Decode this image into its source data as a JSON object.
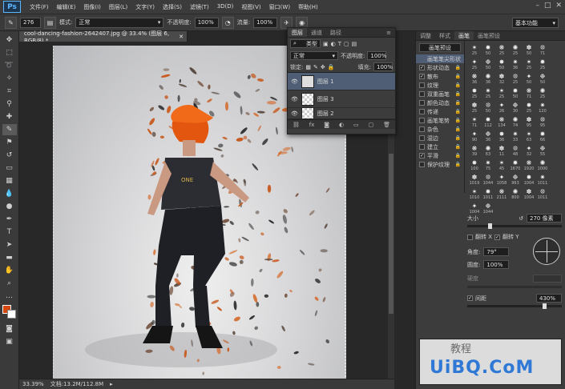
{
  "app": {
    "logo": "Ps",
    "window_buttons": [
      "–",
      "□",
      "✕"
    ]
  },
  "menu": [
    "文件(F)",
    "编辑(E)",
    "图像(I)",
    "图层(L)",
    "文字(Y)",
    "选择(S)",
    "滤镜(T)",
    "3D(D)",
    "视图(V)",
    "窗口(W)",
    "帮助(H)"
  ],
  "options": {
    "brush_size": "276",
    "mode_label": "模式:",
    "mode_value": "正常",
    "opacity_label": "不透明度:",
    "opacity_value": "100%",
    "flow_label": "流量:",
    "flow_value": "100%",
    "workspace": "基本功能"
  },
  "document": {
    "tab_title": "cool-dancing-fashion-2642407.jpg @ 33.4% (图层 6, RGB/8) *",
    "zoom": "33.39%",
    "doc_size": "文档:13.2M/112.8M"
  },
  "layers_panel": {
    "tabs": [
      "图层",
      "通道",
      "路径"
    ],
    "filter_kind": "类型",
    "blend_mode": "正常",
    "opacity_label": "不透明度:",
    "opacity_value": "100%",
    "lock_label": "锁定:",
    "fill_label": "填充:",
    "fill_value": "100%",
    "layers": [
      {
        "name": "图层 1"
      },
      {
        "name": "图层 3"
      },
      {
        "name": "图层 2"
      }
    ]
  },
  "brush_panel": {
    "tabs": [
      "调整",
      "样式",
      "画笔",
      "画笔预设"
    ],
    "preset_button": "画笔预设",
    "options": [
      {
        "label": "画笔笔尖形状",
        "checked": false,
        "active": true
      },
      {
        "label": "形状动态",
        "checked": true
      },
      {
        "label": "散布",
        "checked": true
      },
      {
        "label": "纹理",
        "checked": false
      },
      {
        "label": "双重画笔",
        "checked": false
      },
      {
        "label": "颜色动态",
        "checked": false
      },
      {
        "label": "传递",
        "checked": false
      },
      {
        "label": "画笔笔势",
        "checked": false
      },
      {
        "label": "杂色",
        "checked": false
      },
      {
        "label": "湿边",
        "checked": false
      },
      {
        "label": "建立",
        "checked": false
      },
      {
        "label": "平滑",
        "checked": true
      },
      {
        "label": "保护纹理",
        "checked": false
      }
    ],
    "tips": [
      "25",
      "50",
      "25",
      "25",
      "50",
      "71",
      "25",
      "50",
      "50",
      "36",
      "25",
      "25",
      "36",
      "36",
      "32",
      "25",
      "50",
      "50",
      "25",
      "25",
      "25",
      "50",
      "71",
      "25",
      "25",
      "50",
      "26",
      "30",
      "25",
      "120",
      "71",
      "112",
      "134",
      "74",
      "95",
      "95",
      "90",
      "36",
      "36",
      "33",
      "63",
      "66",
      "39",
      "63",
      "11",
      "48",
      "32",
      "55",
      "100",
      "75",
      "45",
      "1670",
      "1920",
      "1000",
      "1019",
      "1044",
      "1058",
      "963",
      "1004",
      "1011",
      "1010",
      "1011",
      "2111",
      "800",
      "1004",
      "1011",
      "1004",
      "1044"
    ],
    "size_label": "大小",
    "size_value": "270 像素",
    "flip_x": "翻转 X",
    "flip_y": "翻转 Y",
    "angle_label": "角度:",
    "angle_value": "79°",
    "roundness_label": "圆度:",
    "roundness_value": "100%",
    "hardness_label": "硬度",
    "spacing_label": "间距",
    "spacing_value": "430%"
  },
  "watermark": {
    "line1": "UiBQ.CoM",
    "line2": "教程"
  },
  "colors": {
    "foreground": "#d4470f",
    "background": "#ffffff",
    "selection": "#4f5e75"
  }
}
